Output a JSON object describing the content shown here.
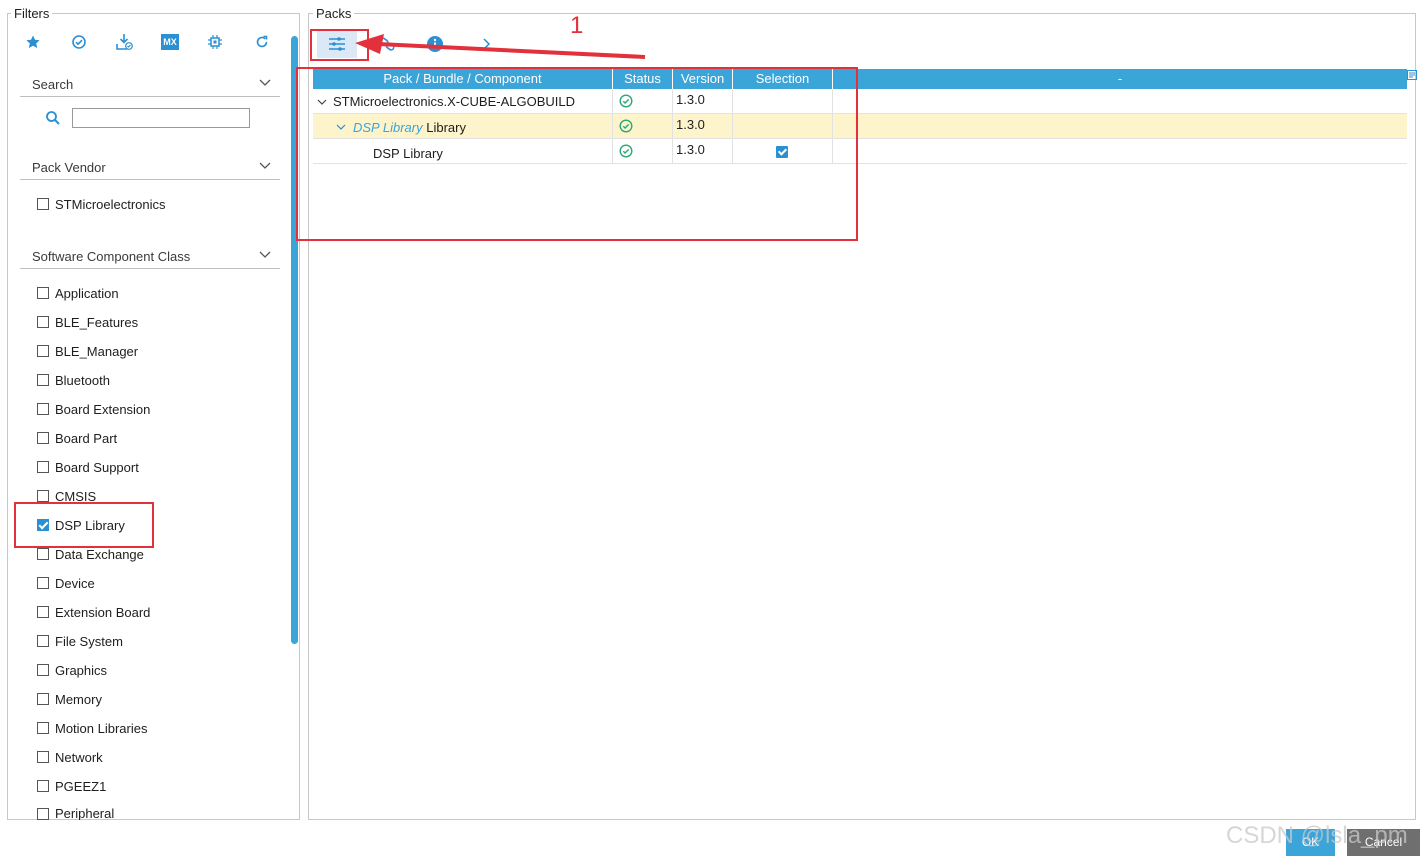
{
  "filters": {
    "title": "Filters",
    "toolbar_icons": [
      "star-icon",
      "check-circle-icon",
      "download-check-icon",
      "mx-icon",
      "chip-icon",
      "refresh-icon"
    ],
    "mx_label": "MX",
    "search": {
      "label": "Search",
      "value": "",
      "placeholder": ""
    },
    "pack_vendor": {
      "label": "Pack Vendor",
      "items": [
        {
          "label": "STMicroelectronics",
          "checked": false
        }
      ]
    },
    "component_class": {
      "label": "Software Component Class",
      "items": [
        {
          "label": "Application",
          "checked": false
        },
        {
          "label": "BLE_Features",
          "checked": false
        },
        {
          "label": "BLE_Manager",
          "checked": false
        },
        {
          "label": "Bluetooth",
          "checked": false
        },
        {
          "label": "Board Extension",
          "checked": false
        },
        {
          "label": "Board Part",
          "checked": false
        },
        {
          "label": "Board Support",
          "checked": false
        },
        {
          "label": "CMSIS",
          "checked": false
        },
        {
          "label": "DSP Library",
          "checked": true
        },
        {
          "label": "Data Exchange",
          "checked": false
        },
        {
          "label": "Device",
          "checked": false
        },
        {
          "label": "Extension Board",
          "checked": false
        },
        {
          "label": "File System",
          "checked": false
        },
        {
          "label": "Graphics",
          "checked": false
        },
        {
          "label": "Memory",
          "checked": false
        },
        {
          "label": "Motion Libraries",
          "checked": false
        },
        {
          "label": "Network",
          "checked": false
        },
        {
          "label": "PGEEZ1",
          "checked": false
        },
        {
          "label": "Peripheral",
          "checked": false
        }
      ]
    }
  },
  "packs": {
    "title": "Packs",
    "toolbar_icons": [
      "sliders-icon",
      "link-icon",
      "info-icon",
      "chevron-right-icon"
    ],
    "columns": [
      "Pack / Bundle / Component",
      "Status",
      "Version",
      "Selection",
      "-"
    ],
    "rows": [
      {
        "name": "STMicroelectronics.X-CUBE-ALGOBUILD",
        "status": "ok",
        "version": "1.3.0",
        "selected": false
      },
      {
        "name_italic": "DSP Library",
        "name_suffix": " Library",
        "status": "ok",
        "version": "1.3.0",
        "selected": false
      },
      {
        "name": "DSP Library",
        "status": "ok",
        "version": "1.3.0",
        "selected": true
      }
    ]
  },
  "annotation": {
    "number": "1",
    "color": "#e2313b"
  },
  "buttons": {
    "ok": "OK",
    "cancel": "Cancel"
  },
  "watermark": "CSDN @lsla_pm",
  "colors": {
    "accent": "#3ba4d9",
    "highlight_row": "#fdf4cc",
    "status_ok": "#2aa876"
  }
}
